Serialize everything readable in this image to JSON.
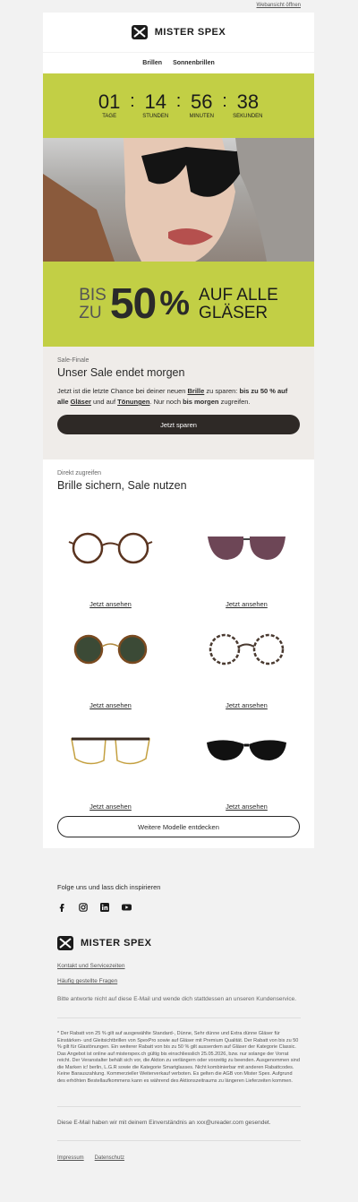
{
  "webview_label": "Webansicht öffnen",
  "brand": {
    "name": "MISTER SPEX"
  },
  "nav": {
    "items": [
      "Brillen",
      "Sonnenbrillen"
    ]
  },
  "countdown": {
    "days": "01",
    "hours": "14",
    "minutes": "56",
    "seconds": "38",
    "days_label": "TAGE",
    "hours_label": "STUNDEN",
    "minutes_label": "MINUTEN",
    "seconds_label": "SEKUNDEN"
  },
  "banner": {
    "bis": "BIS",
    "zu": "ZU",
    "percent": "50",
    "percent_sign": "%",
    "line1": "AUF ALLE",
    "line2": "GLÄSER"
  },
  "sale": {
    "eyebrow": "Sale-Finale",
    "title": "Unser Sale endet morgen",
    "text_1": "Jetzt ist die letzte Chance bei deiner neuen ",
    "link_brille": "Brille",
    "text_2": " zu sparen: ",
    "bold_1": "bis zu 50 % auf alle ",
    "link_glaeser": "Gläser",
    "text_3": " und auf ",
    "link_toenungen": "Tönungen",
    "text_4": ". Nur noch ",
    "bold_2": "bis morgen",
    "text_5": " zugreifen.",
    "cta": "Jetzt sparen"
  },
  "products": {
    "eyebrow": "Direkt zugreifen",
    "title": "Brille sichern, Sale nutzen",
    "items": [
      {
        "link": "Jetzt ansehen"
      },
      {
        "link": "Jetzt ansehen"
      },
      {
        "link": "Jetzt ansehen"
      },
      {
        "link": "Jetzt ansehen"
      },
      {
        "link": "Jetzt ansehen"
      },
      {
        "link": "Jetzt ansehen"
      }
    ],
    "more_button": "Weitere Modelle entdecken"
  },
  "footer": {
    "follow": "Folge uns und lass dich inspirieren",
    "social_icons": [
      "facebook-icon",
      "instagram-icon",
      "linkedin-icon",
      "youtube-icon"
    ],
    "contact_link": "Kontakt und Servicezeiten",
    "faq_link": "Häufig gestellte Fragen",
    "reply_note": "Bitte antworte nicht auf diese E-Mail und wende dich stattdessen an unseren Kundenservice.",
    "disclaimer": "* Der Rabatt von 25 % gilt auf ausgewählte Standard-, Dünne, Sehr dünne und Extra dünne Gläser für Einstärken- und Gleitsichtbrillen von SpexPro sowie auf Gläser mit Premium Qualität. Der Rabatt von bis zu 50 % gilt für Glastönungen. Ein weiterer Rabatt von bis zu 50 % gilt ausserdem auf Gläser der Kategorie Classic. Das Angebot ist online auf misterspex.ch gültig bis einschliesslich 25.05.2026, bzw. nur solange der Vorrat reicht. Der Veranstalter behält sich vor, die Aktion zu verlängern oder vorzeitig zu beenden. Ausgenommen sind die Marken ic! berlin, L.G.R sowie die Kategorie Smartglasses. Nicht kombinierbar mit anderen Rabattcodes. Keine Barauszahlung. Kommerzieller Weiterverkauf verboten. Es gelten die AGB von Mister Spex. Aufgrund des erhöhten Bestellaufkommens kann es während des Aktionszeitraums zu längeren Lieferzeiten kommen.",
    "consent": "Diese E-Mail haben wir mit deinem Einverständnis an xxx@ureader.com gesendet.",
    "impressum": "Impressum",
    "datenschutz": "Datenschutz"
  }
}
